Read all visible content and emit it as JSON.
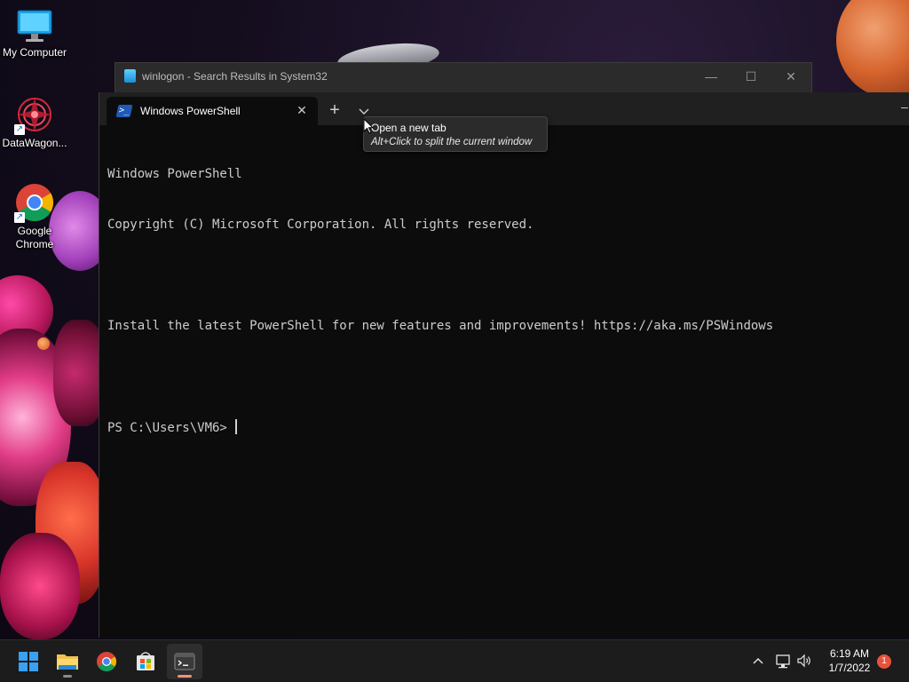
{
  "desktop": {
    "icons": [
      {
        "label": "My Computer",
        "icon": "monitor-icon"
      },
      {
        "label": "DataWagon...",
        "icon": "datawagon-icon"
      },
      {
        "label": "Google Chrome",
        "icon": "chrome-icon"
      }
    ]
  },
  "explorer_window": {
    "title": "winlogon - Search Results in System32",
    "controls": {
      "minimize": "—",
      "maximize": "☐",
      "close": "✕"
    }
  },
  "terminal": {
    "tab_label": "Windows PowerShell",
    "tab_close": "✕",
    "new_tab": "+",
    "dropdown": "⌄",
    "lines": [
      "Windows PowerShell",
      "Copyright (C) Microsoft Corporation. All rights reserved.",
      "",
      "Install the latest PowerShell for new features and improvements! https://aka.ms/PSWindows",
      "",
      "PS C:\\Users\\VM6> "
    ]
  },
  "tooltip": {
    "title": "Open a new tab",
    "hint": "Alt+Click to split the current window"
  },
  "taskbar": {
    "apps": [
      "start-icon",
      "file-explorer-icon",
      "chrome-icon",
      "store-icon",
      "terminal-icon"
    ],
    "clock_time": "6:19 AM",
    "clock_date": "1/7/2022",
    "notification_count": "1"
  },
  "colors": {
    "terminal_bg": "#0c0c0c",
    "tab_strip": "#202020",
    "taskbar": "#1c1c1c",
    "accent": "#0078d4"
  }
}
